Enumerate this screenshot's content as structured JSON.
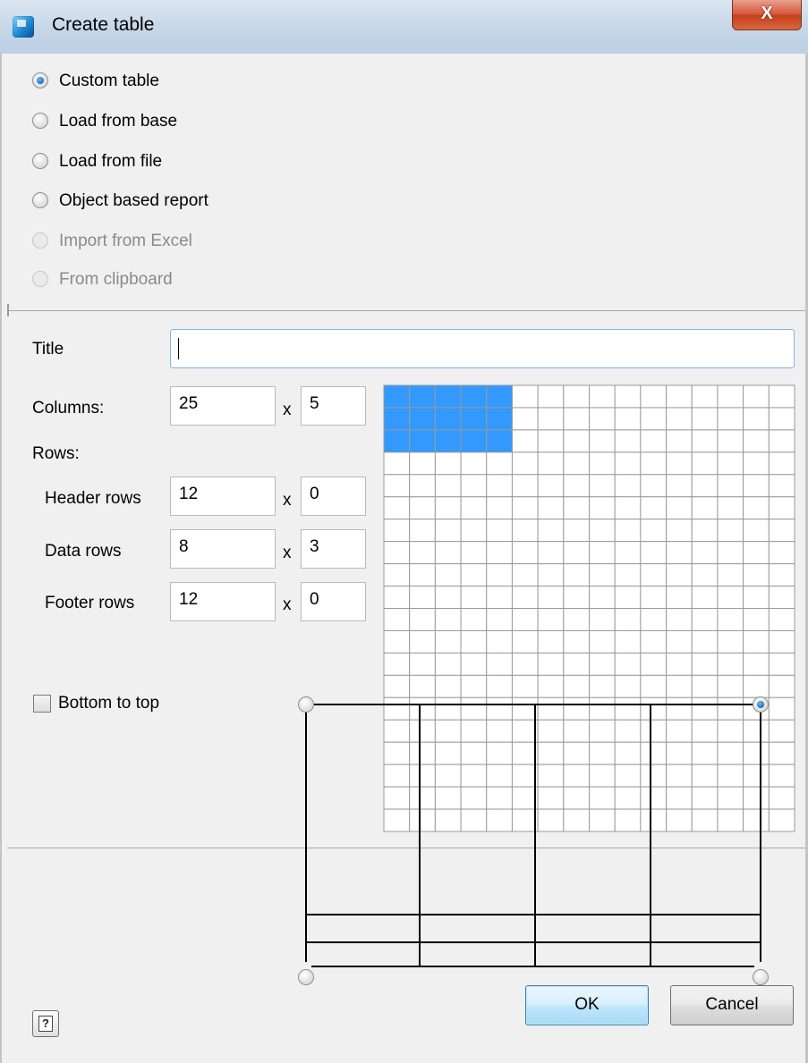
{
  "window": {
    "title": "Create table",
    "close_label": "X"
  },
  "source_options": [
    {
      "label": "Custom table",
      "selected": true,
      "enabled": true
    },
    {
      "label": "Load from base",
      "selected": false,
      "enabled": true
    },
    {
      "label": "Load from file",
      "selected": false,
      "enabled": true
    },
    {
      "label": "Object based report",
      "selected": false,
      "enabled": true
    },
    {
      "label": "Import from Excel",
      "selected": false,
      "enabled": false
    },
    {
      "label": "From clipboard",
      "selected": false,
      "enabled": false
    }
  ],
  "form": {
    "title_label": "Title",
    "title_value": "",
    "columns_label": "Columns:",
    "columns_width": "25",
    "columns_count": "5",
    "times": "x",
    "rows_label": "Rows:",
    "header_rows_label": "Header rows",
    "header_rows_height": "12",
    "header_rows_count": "0",
    "data_rows_label": "Data rows",
    "data_rows_height": "8",
    "data_rows_count": "3",
    "footer_rows_label": "Footer rows",
    "footer_rows_height": "12",
    "footer_rows_count": "0"
  },
  "grid_picker": {
    "total_columns": 16,
    "total_rows": 20,
    "selected_columns": 5,
    "selected_rows": 3,
    "selection_color": "#3399ff"
  },
  "bottom_to_top": {
    "label": "Bottom to top",
    "checked": false
  },
  "origin_preview": {
    "selected_corner": "top-right"
  },
  "buttons": {
    "help_icon": "question-mark",
    "help_glyph": "?",
    "ok": "OK",
    "cancel": "Cancel"
  }
}
